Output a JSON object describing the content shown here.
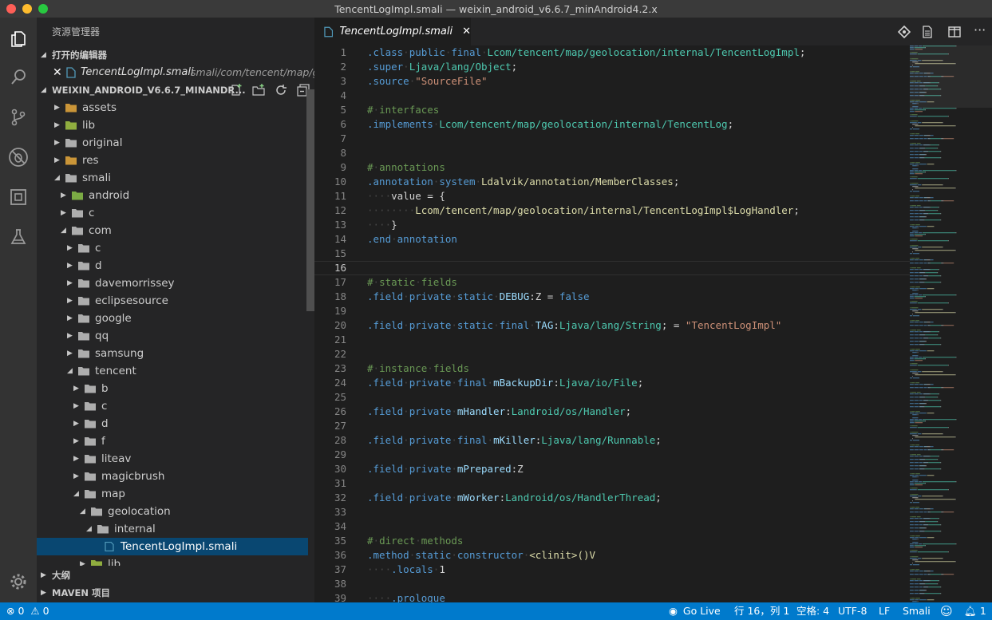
{
  "window": {
    "title": "TencentLogImpl.smali — weixin_android_v6.6.7_minAndroid4.2.x",
    "traffic_colors": [
      "#fe5f57",
      "#febc2e",
      "#28c840"
    ]
  },
  "activity_bar": {
    "icons": [
      "files-icon",
      "search-icon",
      "source-control-icon",
      "debug-icon",
      "extensions-icon",
      "flask-icon"
    ],
    "bottom_icon": "gear-icon"
  },
  "sidebar": {
    "header": "资源管理器",
    "open_editors": {
      "title": "打开的编辑器",
      "items": [
        {
          "name": "TencentLogImpl.smali",
          "path": "smali/com/tencent/map/g..."
        }
      ]
    },
    "project": {
      "title": "WEIXIN_ANDROID_V6.6.7_MINANDR...",
      "tree": [
        {
          "label": "assets",
          "depth": 0,
          "expanded": false,
          "icon": "folder-special"
        },
        {
          "label": "lib",
          "depth": 0,
          "expanded": false,
          "icon": "folder-lib"
        },
        {
          "label": "original",
          "depth": 0,
          "expanded": false,
          "icon": "folder"
        },
        {
          "label": "res",
          "depth": 0,
          "expanded": false,
          "icon": "folder-special"
        },
        {
          "label": "smali",
          "depth": 0,
          "expanded": true,
          "icon": "folder-open"
        },
        {
          "label": "android",
          "depth": 1,
          "expanded": false,
          "icon": "folder-android"
        },
        {
          "label": "c",
          "depth": 1,
          "expanded": false,
          "icon": "folder"
        },
        {
          "label": "com",
          "depth": 1,
          "expanded": true,
          "icon": "folder-open"
        },
        {
          "label": "c",
          "depth": 2,
          "expanded": false,
          "icon": "folder"
        },
        {
          "label": "d",
          "depth": 2,
          "expanded": false,
          "icon": "folder"
        },
        {
          "label": "davemorrissey",
          "depth": 2,
          "expanded": false,
          "icon": "folder"
        },
        {
          "label": "eclipsesource",
          "depth": 2,
          "expanded": false,
          "icon": "folder"
        },
        {
          "label": "google",
          "depth": 2,
          "expanded": false,
          "icon": "folder"
        },
        {
          "label": "qq",
          "depth": 2,
          "expanded": false,
          "icon": "folder"
        },
        {
          "label": "samsung",
          "depth": 2,
          "expanded": false,
          "icon": "folder"
        },
        {
          "label": "tencent",
          "depth": 2,
          "expanded": true,
          "icon": "folder-open"
        },
        {
          "label": "b",
          "depth": 3,
          "expanded": false,
          "icon": "folder"
        },
        {
          "label": "c",
          "depth": 3,
          "expanded": false,
          "icon": "folder"
        },
        {
          "label": "d",
          "depth": 3,
          "expanded": false,
          "icon": "folder"
        },
        {
          "label": "f",
          "depth": 3,
          "expanded": false,
          "icon": "folder"
        },
        {
          "label": "liteav",
          "depth": 3,
          "expanded": false,
          "icon": "folder"
        },
        {
          "label": "magicbrush",
          "depth": 3,
          "expanded": false,
          "icon": "folder"
        },
        {
          "label": "map",
          "depth": 3,
          "expanded": true,
          "icon": "folder-open"
        },
        {
          "label": "geolocation",
          "depth": 4,
          "expanded": true,
          "icon": "folder-open"
        },
        {
          "label": "internal",
          "depth": 5,
          "expanded": true,
          "icon": "folder-open"
        },
        {
          "label": "TencentLogImpl.smali",
          "depth": 6,
          "file": true,
          "selected": true,
          "icon": "file"
        },
        {
          "label": "lib",
          "depth": 4,
          "expanded": false,
          "icon": "folder-lib"
        }
      ]
    },
    "outline_title": "大纲",
    "maven_title": "MAVEN 项目"
  },
  "editor": {
    "tab_label": "TencentLogImpl.smali",
    "current_line": 16,
    "lines": [
      [
        [
          "k",
          ".class"
        ],
        [
          "d",
          "·"
        ],
        [
          "k",
          "public"
        ],
        [
          "d",
          "·"
        ],
        [
          "k",
          "final"
        ],
        [
          "d",
          "·"
        ],
        [
          "t",
          "Lcom/tencent/map/geolocation/internal/TencentLogImpl"
        ],
        [
          "n",
          ";"
        ]
      ],
      [
        [
          "k",
          ".super"
        ],
        [
          "d",
          "·"
        ],
        [
          "t",
          "Ljava/lang/Object"
        ],
        [
          "n",
          ";"
        ]
      ],
      [
        [
          "k",
          ".source"
        ],
        [
          "d",
          "·"
        ],
        [
          "s",
          "\"SourceFile\""
        ]
      ],
      [],
      [
        [
          "c",
          "#"
        ],
        [
          "d",
          "·"
        ],
        [
          "c",
          "interfaces"
        ]
      ],
      [
        [
          "k",
          ".implements"
        ],
        [
          "d",
          "·"
        ],
        [
          "t",
          "Lcom/tencent/map/geolocation/internal/TencentLog"
        ],
        [
          "n",
          ";"
        ]
      ],
      [],
      [],
      [
        [
          "c",
          "#"
        ],
        [
          "d",
          "·"
        ],
        [
          "c",
          "annotations"
        ]
      ],
      [
        [
          "k",
          ".annotation"
        ],
        [
          "d",
          "·"
        ],
        [
          "k",
          "system"
        ],
        [
          "d",
          "·"
        ],
        [
          "f",
          "Ldalvik/annotation/MemberClasses"
        ],
        [
          "n",
          ";"
        ]
      ],
      [
        [
          "d",
          "····"
        ],
        [
          "n",
          "value = {"
        ]
      ],
      [
        [
          "d",
          "········"
        ],
        [
          "f",
          "Lcom/tencent/map/geolocation/internal/TencentLogImpl$LogHandler"
        ],
        [
          "n",
          ";"
        ]
      ],
      [
        [
          "d",
          "····"
        ],
        [
          "n",
          "}"
        ]
      ],
      [
        [
          "k",
          ".end"
        ],
        [
          "d",
          "·"
        ],
        [
          "k",
          "annotation"
        ]
      ],
      [],
      [],
      [
        [
          "c",
          "#"
        ],
        [
          "d",
          "·"
        ],
        [
          "c",
          "static"
        ],
        [
          "d",
          "·"
        ],
        [
          "c",
          "fields"
        ]
      ],
      [
        [
          "k",
          ".field"
        ],
        [
          "d",
          "·"
        ],
        [
          "k",
          "private"
        ],
        [
          "d",
          "·"
        ],
        [
          "k",
          "static"
        ],
        [
          "d",
          "·"
        ],
        [
          "i",
          "DEBUG"
        ],
        [
          "n",
          ":Z = "
        ],
        [
          "k",
          "false"
        ]
      ],
      [],
      [
        [
          "k",
          ".field"
        ],
        [
          "d",
          "·"
        ],
        [
          "k",
          "private"
        ],
        [
          "d",
          "·"
        ],
        [
          "k",
          "static"
        ],
        [
          "d",
          "·"
        ],
        [
          "k",
          "final"
        ],
        [
          "d",
          "·"
        ],
        [
          "i",
          "TAG"
        ],
        [
          "n",
          ":"
        ],
        [
          "t",
          "Ljava/lang/String"
        ],
        [
          "n",
          "; = "
        ],
        [
          "s",
          "\"TencentLogImpl\""
        ]
      ],
      [],
      [],
      [
        [
          "c",
          "#"
        ],
        [
          "d",
          "·"
        ],
        [
          "c",
          "instance"
        ],
        [
          "d",
          "·"
        ],
        [
          "c",
          "fields"
        ]
      ],
      [
        [
          "k",
          ".field"
        ],
        [
          "d",
          "·"
        ],
        [
          "k",
          "private"
        ],
        [
          "d",
          "·"
        ],
        [
          "k",
          "final"
        ],
        [
          "d",
          "·"
        ],
        [
          "i",
          "mBackupDir"
        ],
        [
          "n",
          ":"
        ],
        [
          "t",
          "Ljava/io/File"
        ],
        [
          "n",
          ";"
        ]
      ],
      [],
      [
        [
          "k",
          ".field"
        ],
        [
          "d",
          "·"
        ],
        [
          "k",
          "private"
        ],
        [
          "d",
          "·"
        ],
        [
          "i",
          "mHandler"
        ],
        [
          "n",
          ":"
        ],
        [
          "t",
          "Landroid/os/Handler"
        ],
        [
          "n",
          ";"
        ]
      ],
      [],
      [
        [
          "k",
          ".field"
        ],
        [
          "d",
          "·"
        ],
        [
          "k",
          "private"
        ],
        [
          "d",
          "·"
        ],
        [
          "k",
          "final"
        ],
        [
          "d",
          "·"
        ],
        [
          "i",
          "mKiller"
        ],
        [
          "n",
          ":"
        ],
        [
          "t",
          "Ljava/lang/Runnable"
        ],
        [
          "n",
          ";"
        ]
      ],
      [],
      [
        [
          "k",
          ".field"
        ],
        [
          "d",
          "·"
        ],
        [
          "k",
          "private"
        ],
        [
          "d",
          "·"
        ],
        [
          "i",
          "mPrepared"
        ],
        [
          "n",
          ":Z"
        ]
      ],
      [],
      [
        [
          "k",
          ".field"
        ],
        [
          "d",
          "·"
        ],
        [
          "k",
          "private"
        ],
        [
          "d",
          "·"
        ],
        [
          "i",
          "mWorker"
        ],
        [
          "n",
          ":"
        ],
        [
          "t",
          "Landroid/os/HandlerThread"
        ],
        [
          "n",
          ";"
        ]
      ],
      [],
      [],
      [
        [
          "c",
          "#"
        ],
        [
          "d",
          "·"
        ],
        [
          "c",
          "direct"
        ],
        [
          "d",
          "·"
        ],
        [
          "c",
          "methods"
        ]
      ],
      [
        [
          "k",
          ".method"
        ],
        [
          "d",
          "·"
        ],
        [
          "k",
          "static"
        ],
        [
          "d",
          "·"
        ],
        [
          "k",
          "constructor"
        ],
        [
          "d",
          "·"
        ],
        [
          "f",
          "<clinit>()V"
        ]
      ],
      [
        [
          "d",
          "····"
        ],
        [
          "k",
          ".locals"
        ],
        [
          "d",
          "·"
        ],
        [
          "n",
          "1"
        ]
      ],
      [],
      [
        [
          "d",
          "····"
        ],
        [
          "k",
          ".prologue"
        ]
      ]
    ]
  },
  "status_bar": {
    "errors": "0",
    "warnings": "0",
    "go_live": "Go Live",
    "position": "行 16，列 1",
    "indent": "空格: 4",
    "encoding": "UTF-8",
    "eol": "LF",
    "language": "Smali",
    "notifications": "1"
  }
}
